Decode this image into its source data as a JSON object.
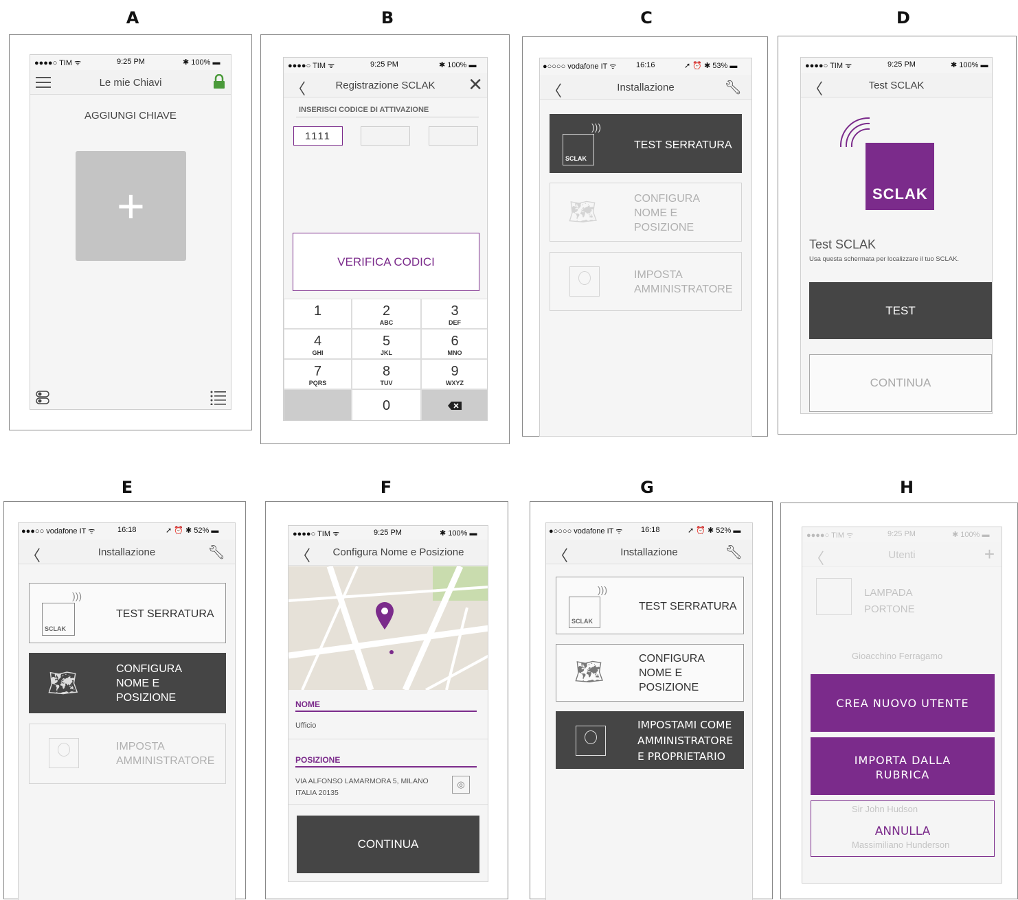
{
  "labels": {
    "a": "A",
    "b": "B",
    "c": "C",
    "d": "D",
    "e": "E",
    "f": "F",
    "g": "G",
    "h": "H"
  },
  "status_tim": {
    "carrier": "●●●●○ TIM ᯤ",
    "time": "9:25 PM",
    "battery": "✱ 100% ▬"
  },
  "status_voda_c": {
    "carrier": "●○○○○ vodafone IT ᯤ",
    "time": "16:16",
    "battery": "➚ ⏰ ✱ 53% ▬"
  },
  "status_voda_e": {
    "carrier": "●●●○○ vodafone IT ᯤ",
    "time": "16:18",
    "battery": "➚ ⏰ ✱ 52% ▬"
  },
  "status_voda_g": {
    "carrier": "●○○○○ vodafone IT ᯤ",
    "time": "16:18",
    "battery": "➚ ⏰ ✱ 52% ▬"
  },
  "a": {
    "title": "Le mie Chiavi",
    "add_key": "AGGIUNGI CHIAVE",
    "plus": "+"
  },
  "b": {
    "title": "Registrazione SCLAK",
    "section": "INSERISCI CODICE DI ATTIVAZIONE",
    "code1": "1111",
    "code2": "",
    "code3": "",
    "verify": "VERIFICA CODICI",
    "keys": [
      {
        "d": "1",
        "s": ""
      },
      {
        "d": "2",
        "s": "ABC"
      },
      {
        "d": "3",
        "s": "DEF"
      },
      {
        "d": "4",
        "s": "GHI"
      },
      {
        "d": "5",
        "s": "JKL"
      },
      {
        "d": "6",
        "s": "MNO"
      },
      {
        "d": "7",
        "s": "PQRS"
      },
      {
        "d": "8",
        "s": "TUV"
      },
      {
        "d": "9",
        "s": "WXYZ"
      },
      {
        "d": "0",
        "s": ""
      }
    ]
  },
  "install": {
    "title": "Installazione",
    "test": "TEST SERRATURA",
    "config1": "CONFIGURA",
    "config2": "NOME E",
    "config3": "POSIZIONE",
    "admin1": "IMPOSTA",
    "admin2": "AMMINISTRATORE",
    "sclak_small": "SCLAK"
  },
  "d": {
    "title": "Test SCLAK",
    "logo": "SCLAK",
    "heading": "Test SCLAK",
    "desc": "Usa questa schermata per localizzare il tuo SCLAK.",
    "test": "TEST",
    "continue": "CONTINUA"
  },
  "f": {
    "title": "Configura Nome e Posizione",
    "name_label": "NOME",
    "name_value": "Ufficio",
    "pos_label": "POSIZIONE",
    "pos_line1": "VIA ALFONSO LAMARMORA 5, MILANO",
    "pos_line2": "ITALIA 20135",
    "continue": "CONTINUA"
  },
  "g": {
    "admin1": "IMPOSTAMI COME",
    "admin2": "AMMINISTRATORE",
    "admin3": "E PROPRIETARIO"
  },
  "h": {
    "title": "Utenti",
    "item1a": "LAMPADA",
    "item1b": "PORTONE",
    "user1": "Gioacchino Ferragamo",
    "user2": "Sir John Hudson",
    "user3": "Massimiliano Hunderson",
    "create": "CREA NUOVO UTENTE",
    "import1": "IMPORTA DALLA",
    "import2": "RUBRICA",
    "cancel": "ANNULLA"
  },
  "colors": {
    "purple": "#7b2b8b",
    "dark": "#454545",
    "green": "#4a9a3a"
  }
}
